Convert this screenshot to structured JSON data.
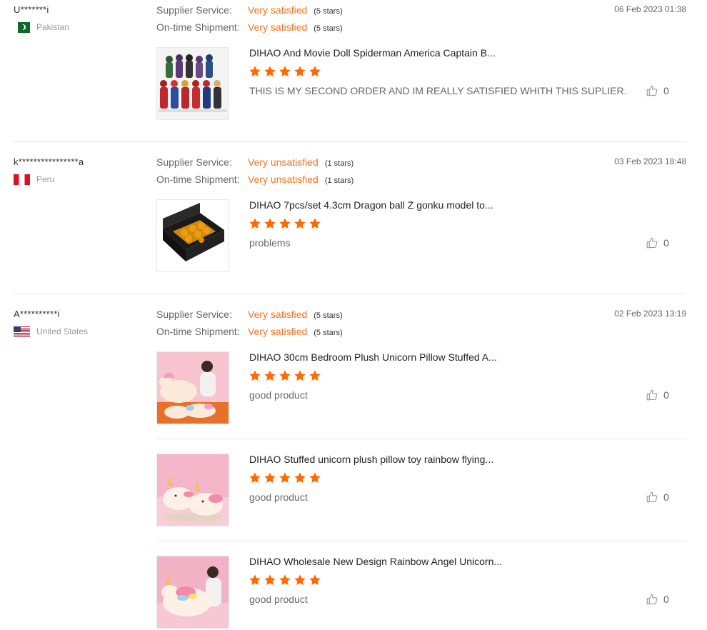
{
  "reviews": [
    {
      "user": "U*******i",
      "country": "Pakistan",
      "date": "06 Feb 2023 01:38",
      "supplier_label": "Supplier Service:",
      "supplier_value": "Very satisfied",
      "supplier_stars": "(5 stars)",
      "shipment_label": "On-time Shipment:",
      "shipment_value": "Very satisfied",
      "shipment_stars": "(5 stars)",
      "products": [
        {
          "title": "DIHAO And Movie Doll Spiderman America Captain B...",
          "rating": 5,
          "comment": "THIS IS MY SECOND ORDER AND IM REALLY SATISFIED WHITH THIS SUPLIER.",
          "likes": "0"
        }
      ]
    },
    {
      "user": "k****************a",
      "country": "Peru",
      "date": "03 Feb 2023 18:48",
      "supplier_label": "Supplier Service:",
      "supplier_value": "Very unsatisfied",
      "supplier_stars": "(1 stars)",
      "shipment_label": "On-time Shipment:",
      "shipment_value": "Very unsatisfied",
      "shipment_stars": "(1 stars)",
      "products": [
        {
          "title": "DIHAO 7pcs/set 4.3cm Dragon ball Z gonku model to...",
          "rating": 5,
          "comment": "problems",
          "likes": "0"
        }
      ]
    },
    {
      "user": "A**********i",
      "country": "United States",
      "date": "02 Feb 2023 13:19",
      "supplier_label": "Supplier Service:",
      "supplier_value": "Very satisfied",
      "supplier_stars": "(5 stars)",
      "shipment_label": "On-time Shipment:",
      "shipment_value": "Very satisfied",
      "shipment_stars": "(5 stars)",
      "products": [
        {
          "title": "DIHAO 30cm Bedroom Plush Unicorn Pillow Stuffed A...",
          "rating": 5,
          "comment": "good product",
          "likes": "0"
        },
        {
          "title": "DIHAO Stuffed unicorn plush pillow toy rainbow flying...",
          "rating": 5,
          "comment": "good product",
          "likes": "0"
        },
        {
          "title": "DIHAO Wholesale New Design Rainbow Angel Unicorn...",
          "rating": 5,
          "comment": "good product",
          "likes": "0"
        }
      ]
    }
  ],
  "colors": {
    "accent": "#f5721f",
    "star": "#ff6a00",
    "divider": "#e5e5e5"
  },
  "icons": {
    "star": "star-icon",
    "like": "thumbs-up-icon"
  }
}
